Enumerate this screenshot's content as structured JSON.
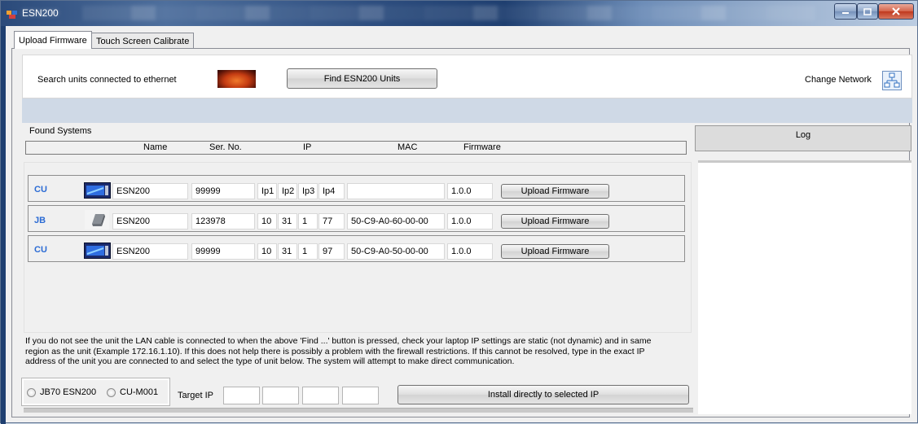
{
  "window": {
    "title": "ESN200"
  },
  "tabs": [
    {
      "label": "Upload Firmware",
      "active": true
    },
    {
      "label": "Touch Screen Calibrate",
      "active": false
    }
  ],
  "search": {
    "label": "Search units connected to ethernet",
    "find_button": "Find ESN200 Units",
    "change_network": "Change Network"
  },
  "found": {
    "title": "Found Systems",
    "columns": [
      "Name",
      "Ser. No.",
      "IP",
      "MAC",
      "Firmware"
    ],
    "rows": [
      {
        "kind": "CU",
        "name": "ESN200",
        "serial": "99999",
        "ip": [
          "Ip1",
          "Ip2",
          "Ip3",
          "Ip4"
        ],
        "mac": "",
        "firmware": "1.0.0",
        "button": "Upload Firmware"
      },
      {
        "kind": "JB",
        "name": "ESN200",
        "serial": "123978",
        "ip": [
          "10",
          "31",
          "1",
          "77"
        ],
        "mac": "50-C9-A0-60-00-00",
        "firmware": "1.0.0",
        "button": "Upload Firmware"
      },
      {
        "kind": "CU",
        "name": "ESN200",
        "serial": "99999",
        "ip": [
          "10",
          "31",
          "1",
          "97"
        ],
        "mac": "50-C9-A0-50-00-00",
        "firmware": "1.0.0",
        "button": "Upload Firmware"
      }
    ]
  },
  "log": {
    "title": "Log"
  },
  "help": {
    "line1": "If you do not see the unit the LAN cable is connected to when the above 'Find ...' button is pressed, check your laptop IP settings are static (not dynamic) and in same",
    "line2": "region as the unit (Example 172.16.1.10). If this does not help there is possibly a problem with the firewall restrictions. If this cannot be resolved, type in the exact IP",
    "line3": "address of the unit you are connected to and select the type of unit below. The system will attempt to make direct communication."
  },
  "direct": {
    "option1": "JB70 ESN200",
    "option2": "CU-M001",
    "target_label": "Target IP",
    "install_button": "Install directly to selected IP"
  },
  "colors": {
    "kind_label": "#2b6bd4",
    "title_bar": "#2b4a7a"
  }
}
